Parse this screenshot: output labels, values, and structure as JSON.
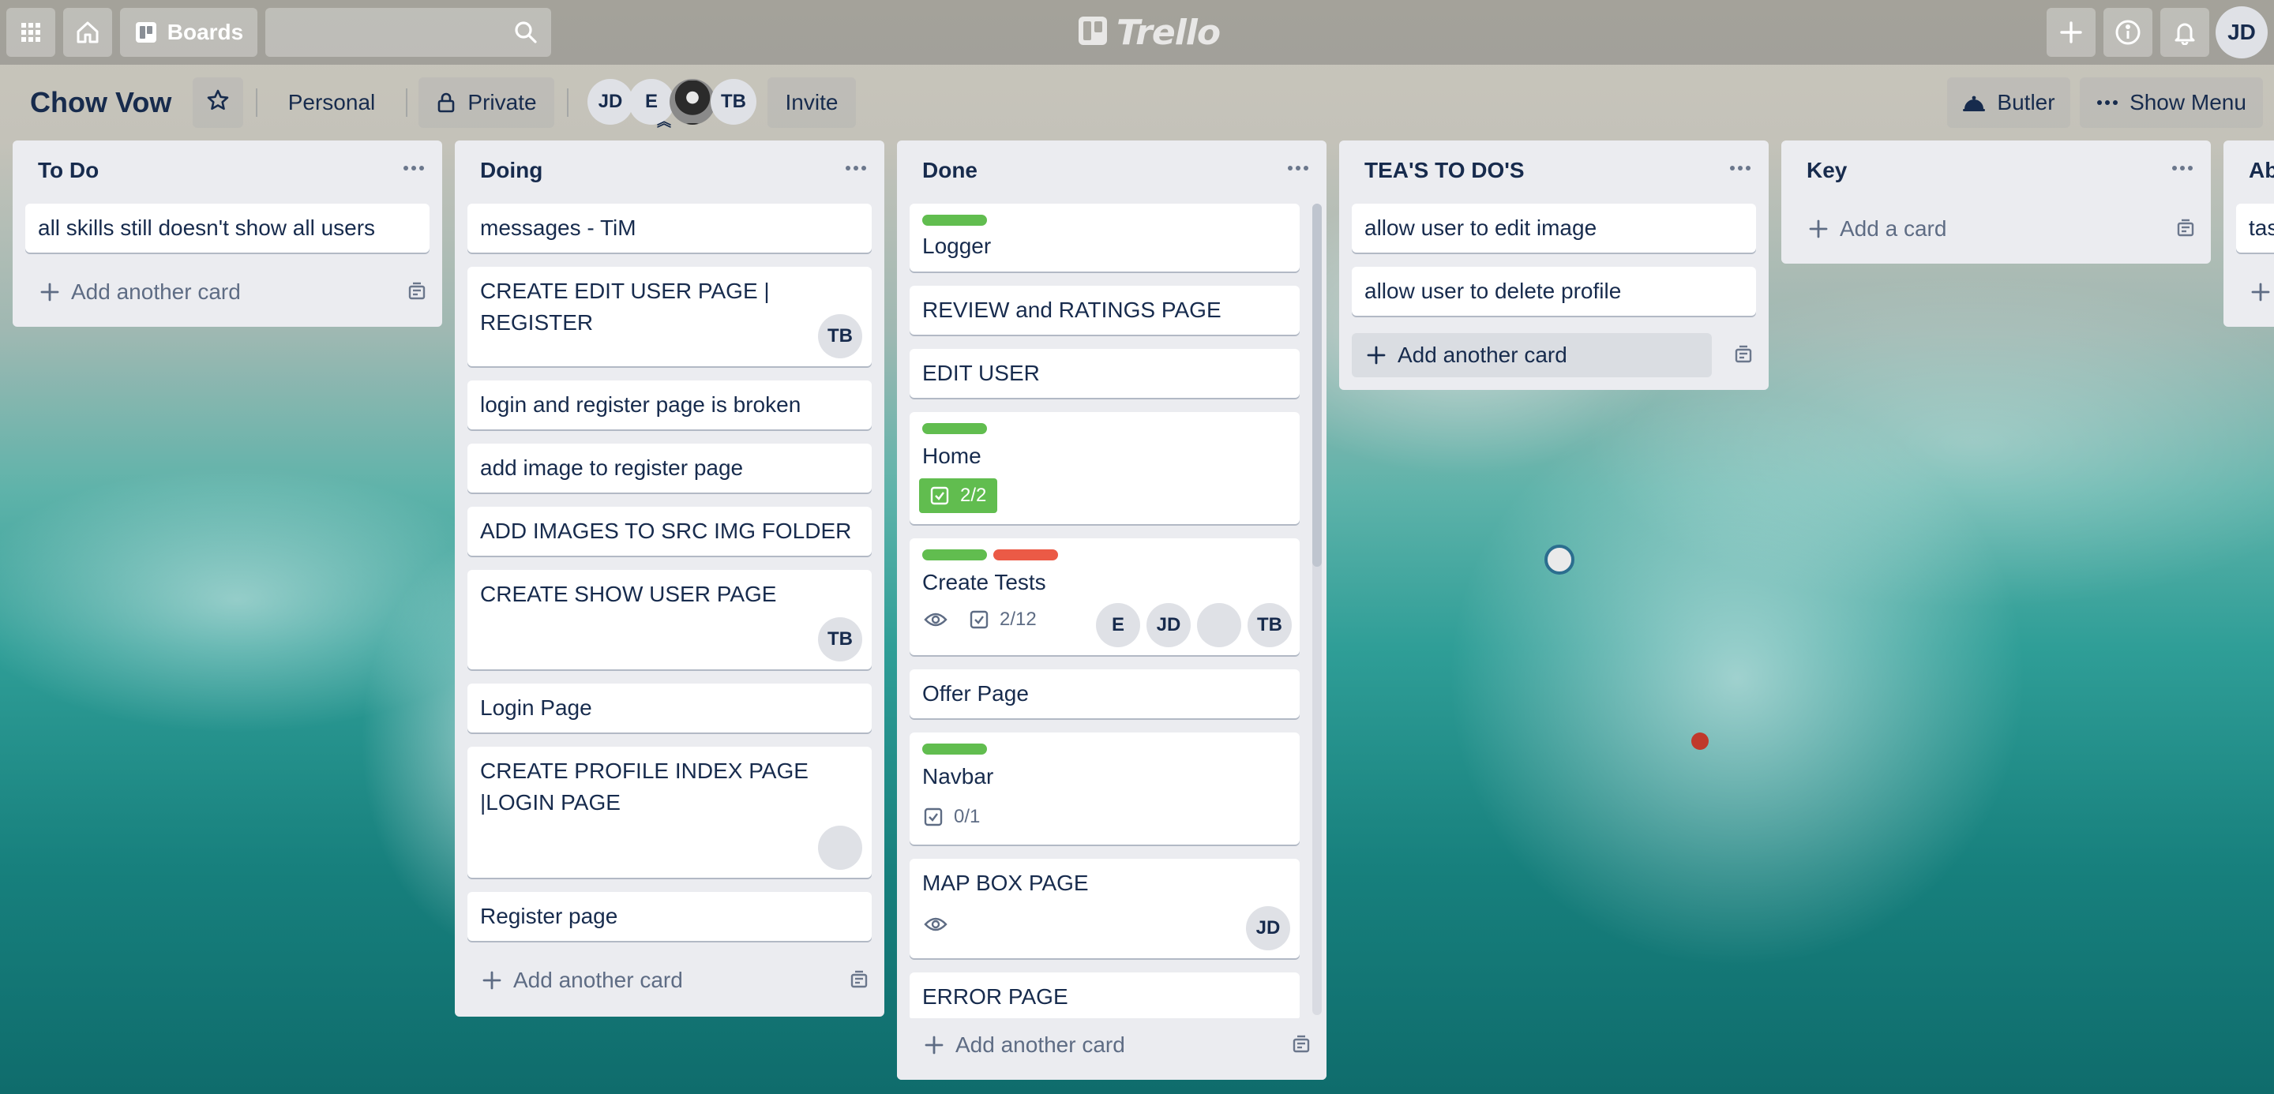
{
  "header": {
    "boards_label": "Boards",
    "search_placeholder": "",
    "logo_text": "Trello",
    "user_initials": "JD"
  },
  "board": {
    "title": "Chow Vow",
    "team": "Personal",
    "visibility": "Private",
    "members": [
      "JD",
      "E",
      "",
      "TB"
    ],
    "invite_label": "Invite",
    "butler_label": "Butler",
    "show_menu_label": "Show Menu"
  },
  "lists": [
    {
      "title": "To Do",
      "cards": [
        "all skills still doesn't show all users"
      ],
      "add_label": "Add another card"
    },
    {
      "title": "Doing",
      "cards": [
        "messages - TiM",
        "CREATE EDIT USER PAGE | REGISTER",
        "login and register page is broken",
        "add image to register page",
        "ADD IMAGES TO SRC IMG FOLDER",
        "CREATE SHOW USER PAGE",
        "Login Page",
        "CREATE PROFILE INDEX PAGE |LOGIN PAGE",
        "Register page"
      ],
      "card_members": {
        "card_2": "TB",
        "card_6": "TB"
      },
      "add_label": "Add another card"
    },
    {
      "title": "Done",
      "cards": [
        "Logger",
        "REVIEW and RATINGS PAGE",
        "EDIT USER",
        "Home",
        "Create Tests",
        "Offer Page",
        "Navbar",
        "MAP BOX PAGE",
        "ERROR PAGE"
      ],
      "home_checklist": "2/2",
      "create_tests_checklist": "2/12",
      "create_tests_members": [
        "E",
        "JD",
        "",
        "TB"
      ],
      "navbar_checklist": "0/1",
      "map_box_member": "JD",
      "add_label": "Add another card"
    },
    {
      "title": "TEA'S TO DO'S",
      "cards": [
        "allow user to edit image",
        "allow user to delete profile"
      ],
      "add_label": "Add another card"
    },
    {
      "title": "Key",
      "cards": [],
      "add_label": "Add a card"
    },
    {
      "title": "Ab",
      "cards": [
        "tas"
      ],
      "add_label": ""
    }
  ],
  "colors": {
    "label_green": "#61bd4f",
    "label_red": "#eb5a46",
    "list_bg": "#ebecf0",
    "text": "#172b4d"
  },
  "icons": [
    "apps-icon",
    "home-icon",
    "boards-icon",
    "search-icon",
    "plus-icon",
    "info-icon",
    "bell-icon",
    "star-icon",
    "lock-icon",
    "butler-icon",
    "ellipsis-icon",
    "template-icon",
    "eye-icon",
    "checklist-icon"
  ]
}
